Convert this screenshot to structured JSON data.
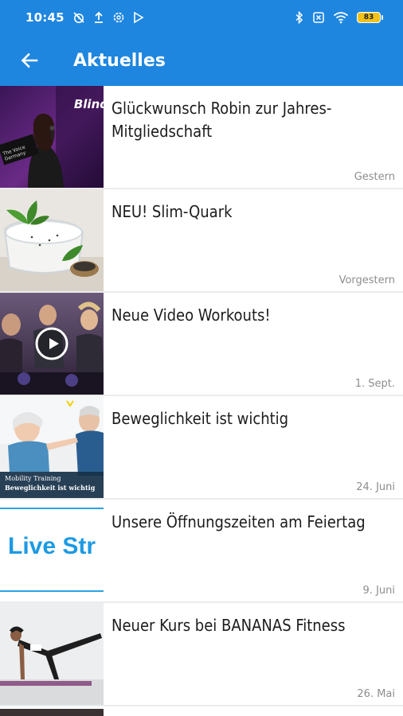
{
  "status_bar": {
    "time": "10:45",
    "battery": "83"
  },
  "header": {
    "title": "Aktuelles",
    "back_icon": "arrow-left-icon",
    "color": "#1e86df"
  },
  "news": [
    {
      "title": "Glückwunsch Robin zur Jahres-Mitgliedschaft",
      "date": "Gestern",
      "thumb": "concert-stage-photo",
      "thumb_text": "Blind",
      "thumb_text2": "The Voice Germany"
    },
    {
      "title": "NEU! Slim-Quark",
      "date": "Vorgestern",
      "thumb": "quark-bowl-mint-photo"
    },
    {
      "title": "Neue Video Workouts!",
      "date": "1. Sept.",
      "thumb": "spinning-class-video",
      "thumb_icon": "play-icon"
    },
    {
      "title": "Beweglichkeit ist wichtig",
      "date": "24. Juni",
      "thumb": "mobility-training-seniors",
      "thumb_text": "Mobility Training",
      "thumb_text2": "Beweglichkeit ist wichtig"
    },
    {
      "title": "Unsere Öffnungszeiten am Feiertag",
      "date": "9. Juni",
      "thumb": "live-stream-banner",
      "thumb_text": "Live Str"
    },
    {
      "title": "Neuer Kurs bei BANANAS Fitness",
      "date": "26. Mai",
      "thumb": "yoga-pose-photo"
    }
  ]
}
